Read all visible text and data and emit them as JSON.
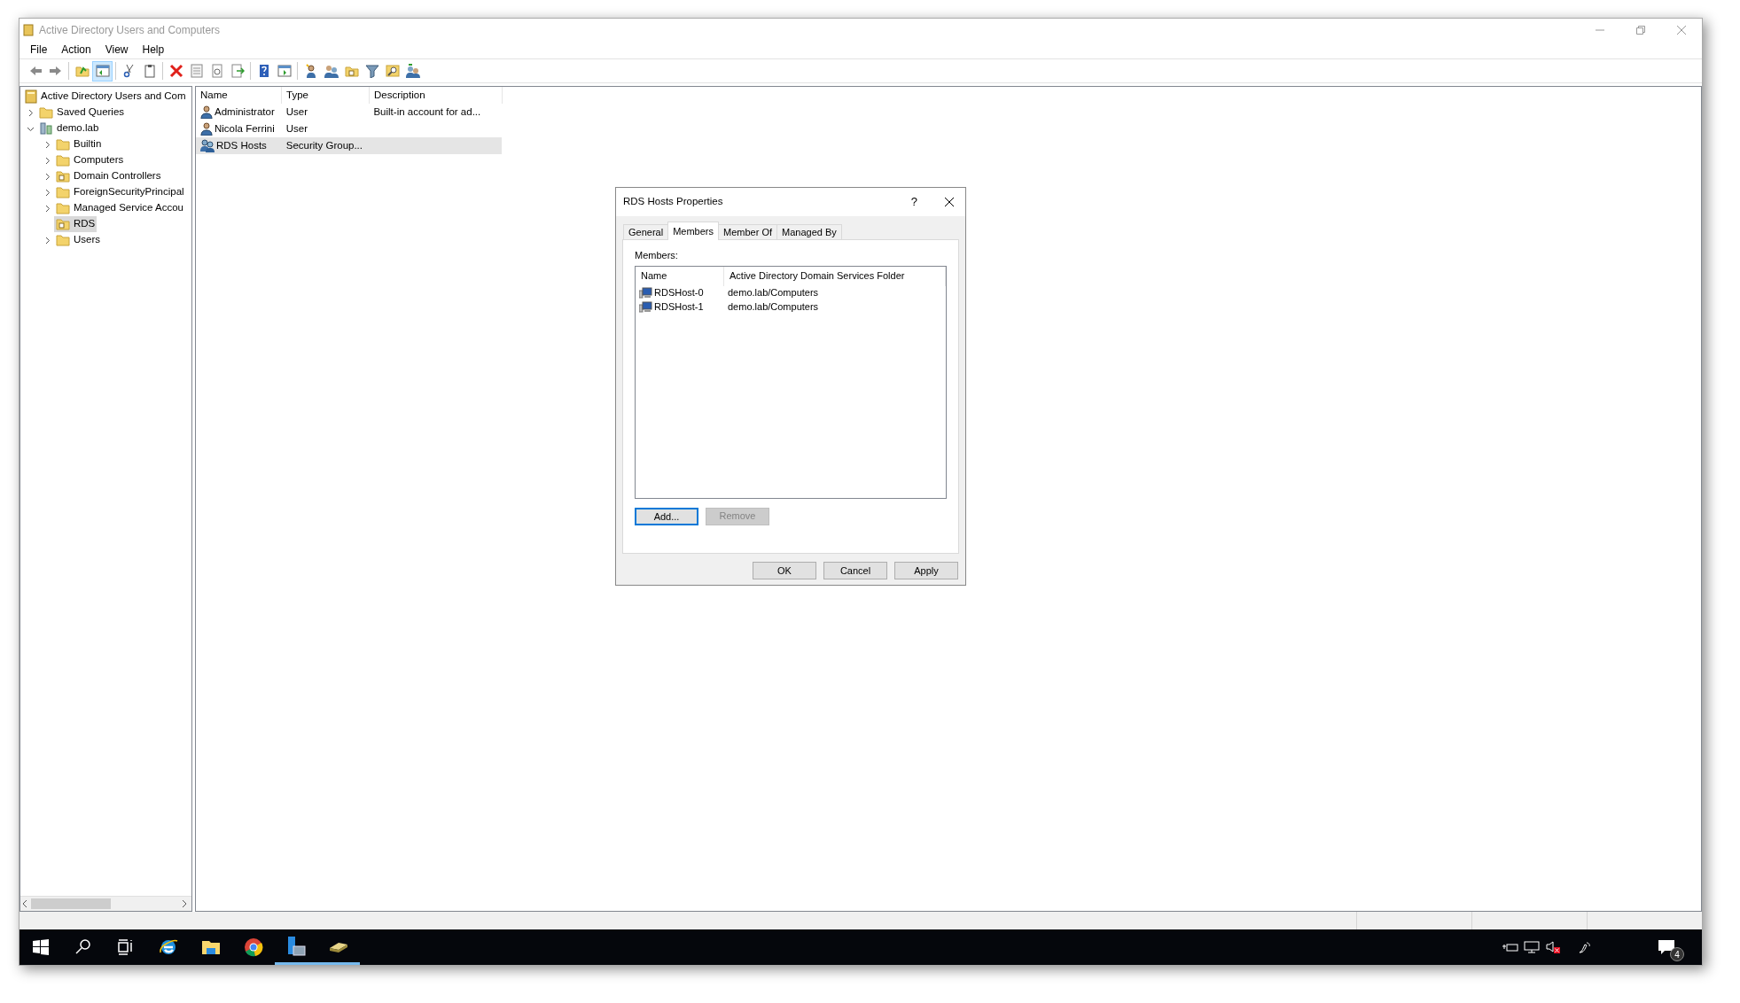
{
  "window": {
    "title": "Active Directory Users and Computers"
  },
  "menu": [
    {
      "label": "File"
    },
    {
      "label": "Action"
    },
    {
      "label": "View"
    },
    {
      "label": "Help"
    }
  ],
  "toolbar": [
    {
      "pressed": false
    },
    {
      "pressed": false
    },
    {
      "pressed": false
    },
    {
      "pressed": true
    },
    {
      "pressed": false
    },
    {
      "pressed": false
    },
    {
      "pressed": false
    },
    {
      "pressed": false
    },
    {
      "pressed": false
    },
    {
      "pressed": false
    },
    {
      "pressed": false
    },
    {
      "pressed": false
    },
    {
      "pressed": false
    },
    {
      "pressed": false
    },
    {
      "pressed": false
    },
    {
      "pressed": false
    },
    {
      "pressed": false
    },
    {
      "pressed": false
    }
  ],
  "tree": {
    "items": [
      {
        "label": "Active Directory Users and Com",
        "kind": "root",
        "selected": false,
        "children": [
          {
            "label": "Saved Queries",
            "kind": "folder",
            "expanded": false,
            "selected": false
          },
          {
            "label": "demo.lab",
            "kind": "domain",
            "expanded": true,
            "selected": false,
            "children": [
              {
                "label": "Builtin",
                "kind": "folder",
                "expanded": false,
                "selected": false
              },
              {
                "label": "Computers",
                "kind": "folder",
                "expanded": false,
                "selected": false
              },
              {
                "label": "Domain Controllers",
                "kind": "ou",
                "expanded": false,
                "selected": false
              },
              {
                "label": "ForeignSecurityPrincipal",
                "kind": "folder",
                "expanded": false,
                "selected": false
              },
              {
                "label": "Managed Service Accou",
                "kind": "folder",
                "expanded": false,
                "selected": false
              },
              {
                "label": "RDS",
                "kind": "ou",
                "selected": true
              },
              {
                "label": "Users",
                "kind": "folder",
                "expanded": false,
                "selected": false
              }
            ]
          }
        ]
      }
    ]
  },
  "list": {
    "columns": [
      "Name",
      "Type",
      "Description"
    ],
    "rows": [
      {
        "kind": "user",
        "name": "Administrator",
        "type": "User",
        "description": "Built-in account for ad...",
        "selected": false
      },
      {
        "kind": "user",
        "name": "Nicola Ferrini",
        "type": "User",
        "selected": false
      },
      {
        "kind": "group",
        "name": "RDS Hosts",
        "type": "Security Group...",
        "selected": true
      }
    ]
  },
  "dialog": {
    "title": "RDS Hosts Properties",
    "help": "?",
    "tabs": [
      {
        "label": "General",
        "selected": false
      },
      {
        "label": "Members",
        "selected": true
      },
      {
        "label": "Member Of",
        "selected": false
      },
      {
        "label": "Managed By",
        "selected": false
      }
    ],
    "members_label": "Members:",
    "columns": [
      "Name",
      "Active Directory Domain Services Folder"
    ],
    "rows": [
      {
        "name": "RDSHost-0",
        "folder": "demo.lab/Computers"
      },
      {
        "name": "RDSHost-1",
        "folder": "demo.lab/Computers"
      }
    ],
    "list_buttons": [
      {
        "label": "Add...",
        "focused": true,
        "disabled": false
      },
      {
        "label": "Remove",
        "focused": false,
        "disabled": true
      }
    ],
    "buttons": [
      {
        "label": "OK"
      },
      {
        "label": "Cancel"
      },
      {
        "label": "Apply"
      }
    ]
  },
  "taskbar": {
    "apps": [
      {
        "kind": "browser-e",
        "running": false
      },
      {
        "kind": "folder",
        "running": false
      },
      {
        "kind": "chrome",
        "running": false
      },
      {
        "kind": "server",
        "running": true
      },
      {
        "kind": "book",
        "running": true
      }
    ],
    "notifications": "4"
  }
}
